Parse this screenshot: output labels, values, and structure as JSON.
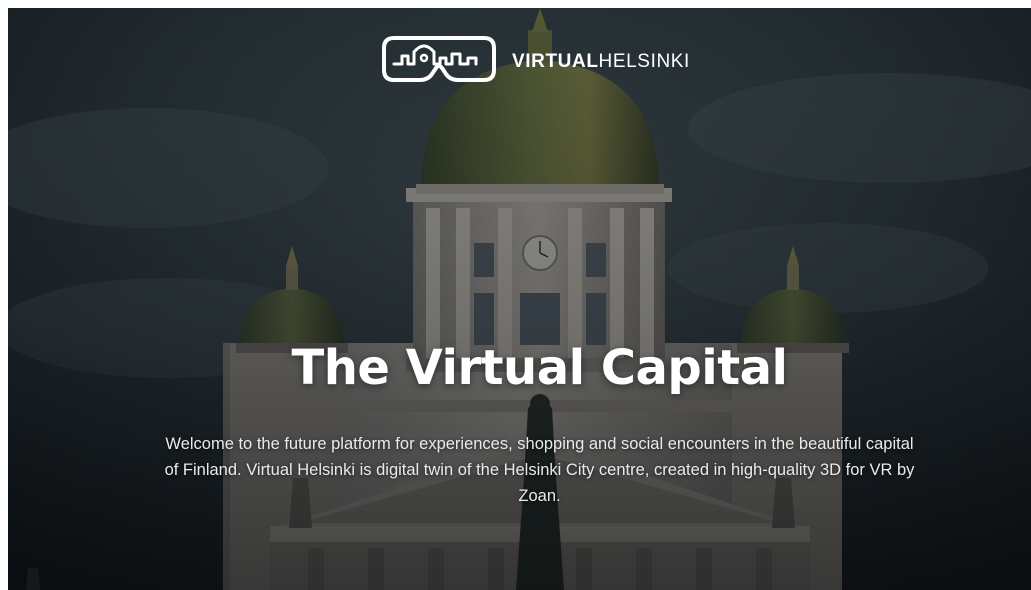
{
  "brand": {
    "name_bold": "VIRTUAL",
    "name_light": "HELSINKI",
    "logo_icon": "vr-headset-skyline-icon"
  },
  "hero": {
    "title": "The Virtual Capital",
    "description": "Welcome to the future platform for experiences, shopping and social encounters in the beautiful capital of Finland. Virtual Helsinki is digital twin of the Helsinki City centre, created in high-quality 3D for VR by Zoan.",
    "background_image": "helsinki-cathedral-photo"
  },
  "colors": {
    "sky": "#2b3a40",
    "dome": "#5a6b3e",
    "facade": "#b9b4aa",
    "text": "#ffffff"
  }
}
